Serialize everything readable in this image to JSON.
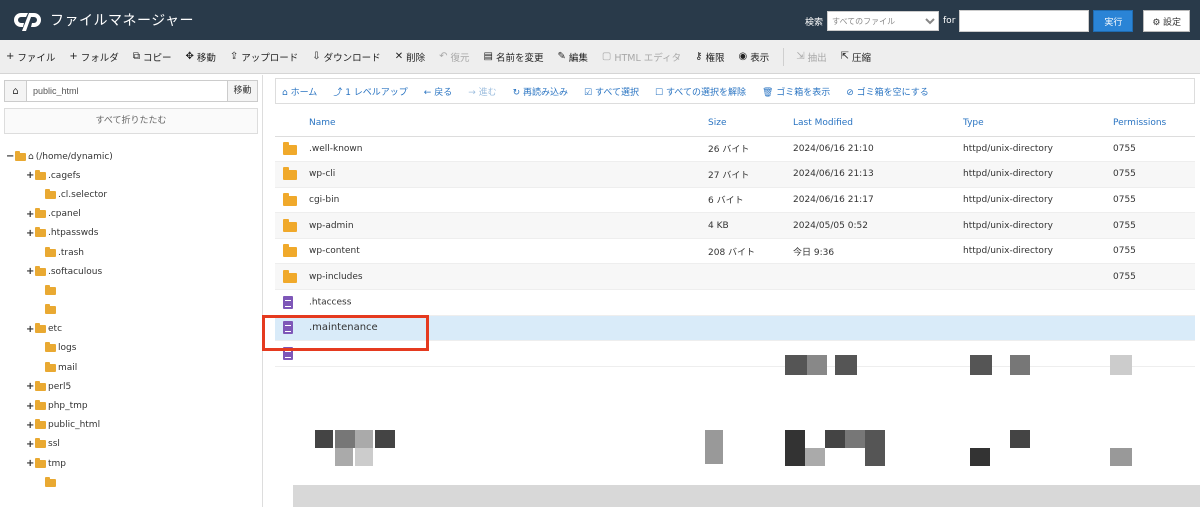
{
  "header": {
    "title": "ファイルマネージャー",
    "search_label": "検索",
    "search_scope": "すべてのファイル",
    "search_for_label": "for",
    "search_value": "",
    "go_label": "実行",
    "settings_label": "設定",
    "colors": {
      "header_bg": "#293a4a",
      "accent": "#2a84d6"
    }
  },
  "toolbar": {
    "items": [
      {
        "icon": "plus-icon",
        "glyph": "+",
        "label": "ファイル"
      },
      {
        "icon": "plus-icon",
        "glyph": "+",
        "label": "フォルダ"
      },
      {
        "icon": "copy-icon",
        "glyph": "⧉",
        "label": "コピー"
      },
      {
        "icon": "move-icon",
        "glyph": "✥",
        "label": "移動"
      },
      {
        "icon": "upload-icon",
        "glyph": "⇪",
        "label": "アップロード"
      },
      {
        "icon": "download-icon",
        "glyph": "⇩",
        "label": "ダウンロード"
      },
      {
        "icon": "delete-icon",
        "glyph": "✕",
        "label": "削除"
      },
      {
        "icon": "restore-icon",
        "glyph": "↶",
        "label": "復元",
        "disabled": true
      },
      {
        "icon": "rename-icon",
        "glyph": "▤",
        "label": "名前を変更"
      },
      {
        "icon": "edit-icon",
        "glyph": "✎",
        "label": "編集"
      },
      {
        "icon": "html-editor-icon",
        "glyph": "▢",
        "label": "HTML エディタ",
        "disabled": true
      },
      {
        "icon": "permissions-icon",
        "glyph": "⚷",
        "label": "権限"
      },
      {
        "icon": "view-icon",
        "glyph": "◉",
        "label": "表示"
      },
      {
        "icon": "extract-icon",
        "glyph": "⇲",
        "label": "抽出",
        "disabled": true
      },
      {
        "icon": "compress-icon",
        "glyph": "⇱",
        "label": "圧縮"
      }
    ]
  },
  "sidebar": {
    "path_value": "public_html",
    "go_label": "移動",
    "collapse_label": "すべて折りたたむ",
    "tree": [
      {
        "label": "(/home/dynamic)",
        "indent": 0,
        "toggle": "−",
        "root": true
      },
      {
        "label": ".cagefs",
        "indent": 1,
        "toggle": "+"
      },
      {
        "label": ".cl.selector",
        "indent": 2,
        "toggle": ""
      },
      {
        "label": ".cpanel",
        "indent": 1,
        "toggle": "+"
      },
      {
        "label": ".htpasswds",
        "indent": 1,
        "toggle": "+"
      },
      {
        "label": ".trash",
        "indent": 2,
        "toggle": ""
      },
      {
        "label": ".softaculous",
        "indent": 1,
        "toggle": "+"
      },
      {
        "label": "",
        "indent": 2,
        "toggle": ""
      },
      {
        "label": "",
        "indent": 2,
        "toggle": ""
      },
      {
        "label": "etc",
        "indent": 1,
        "toggle": "+"
      },
      {
        "label": "logs",
        "indent": 2,
        "toggle": ""
      },
      {
        "label": "mail",
        "indent": 2,
        "toggle": ""
      },
      {
        "label": "perl5",
        "indent": 1,
        "toggle": "+"
      },
      {
        "label": "php_tmp",
        "indent": 1,
        "toggle": "+"
      },
      {
        "label": "public_html",
        "indent": 1,
        "toggle": "+"
      },
      {
        "label": "ssl",
        "indent": 1,
        "toggle": "+"
      },
      {
        "label": "tmp",
        "indent": 1,
        "toggle": "+"
      },
      {
        "label": "",
        "indent": 2,
        "toggle": ""
      }
    ]
  },
  "actions": [
    {
      "label": "ホーム",
      "icon": "home-icon",
      "glyph": "⌂"
    },
    {
      "label": "1 レベルアップ",
      "icon": "level-up-icon",
      "glyph": "⤴"
    },
    {
      "label": "戻る",
      "icon": "back-icon",
      "glyph": "←"
    },
    {
      "label": "進む",
      "icon": "forward-icon",
      "glyph": "→",
      "disabled": true
    },
    {
      "label": "再読み込み",
      "icon": "reload-icon",
      "glyph": "↻"
    },
    {
      "label": "すべて選択",
      "icon": "select-all-icon",
      "glyph": "☑"
    },
    {
      "label": "すべての選択を解除",
      "icon": "unselect-icon",
      "glyph": "☐"
    },
    {
      "label": "ゴミ箱を表示",
      "icon": "trash-icon",
      "glyph": "🗑"
    },
    {
      "label": "ゴミ箱を空にする",
      "icon": "empty-trash-icon",
      "glyph": "⊘"
    }
  ],
  "table": {
    "columns": [
      "Name",
      "Size",
      "Last Modified",
      "Type",
      "Permissions"
    ],
    "rows": [
      {
        "icon": "folder",
        "name": ".well-known",
        "size": "26 バイト",
        "modified": "2024/06/16 21:10",
        "type": "httpd/unix-directory",
        "perm": "0755"
      },
      {
        "icon": "folder",
        "name": "wp-cli",
        "size": "27 バイト",
        "modified": "2024/06/16 21:13",
        "type": "httpd/unix-directory",
        "perm": "0755"
      },
      {
        "icon": "folder",
        "name": "cgi-bin",
        "size": "6 バイト",
        "modified": "2024/06/16 21:17",
        "type": "httpd/unix-directory",
        "perm": "0755"
      },
      {
        "icon": "folder",
        "name": "wp-admin",
        "size": "4 KB",
        "modified": "2024/05/05 0:52",
        "type": "httpd/unix-directory",
        "perm": "0755"
      },
      {
        "icon": "folder",
        "name": "wp-content",
        "size": "208 バイト",
        "modified": "今日 9:36",
        "type": "httpd/unix-directory",
        "perm": "0755"
      },
      {
        "icon": "folder",
        "name": "wp-includes",
        "size": "",
        "modified": "",
        "type": "",
        "perm": "0755"
      },
      {
        "icon": "file",
        "name": ".htaccess",
        "size": "",
        "modified": "",
        "type": "",
        "perm": ""
      },
      {
        "icon": "file",
        "name": ".maintenance",
        "size": "",
        "modified": "",
        "type": "",
        "perm": "",
        "selected": true
      },
      {
        "icon": "file",
        "name": "",
        "size": "",
        "modified": "",
        "type": "",
        "perm": ""
      }
    ]
  }
}
